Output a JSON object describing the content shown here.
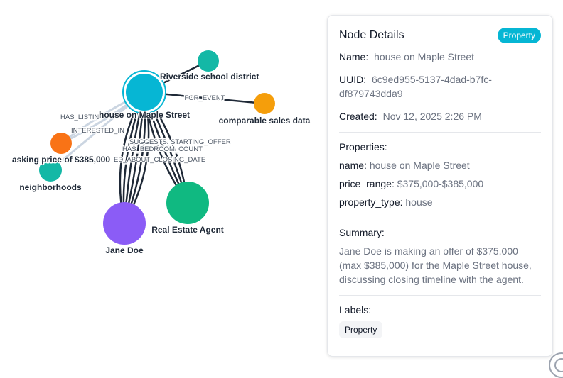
{
  "graph": {
    "colors": {
      "edge": "#1f2937",
      "edge_highlight": "#cbd5e1",
      "property": "#06b6d4",
      "entity": "#14b8a6",
      "event": "#f59e0b",
      "price": "#f97316",
      "person": "#8b5cf6",
      "agent": "#10b981",
      "selected_ring": "#06b6d4"
    },
    "nodes": [
      {
        "id": "house",
        "label": "house on Maple Street",
        "type": "property",
        "selected": true
      },
      {
        "id": "school",
        "label": "Riverside school district",
        "type": "entity"
      },
      {
        "id": "sales",
        "label": "comparable sales data",
        "type": "event"
      },
      {
        "id": "price",
        "label": "asking price of $385,000",
        "type": "price"
      },
      {
        "id": "hoods",
        "label": "neighborhoods",
        "type": "entity"
      },
      {
        "id": "jane",
        "label": "Jane Doe",
        "type": "person"
      },
      {
        "id": "agent",
        "label": "Real Estate Agent",
        "type": "agent"
      }
    ],
    "edges": [
      {
        "from": "house",
        "to": "school",
        "count": 1
      },
      {
        "from": "house",
        "to": "sales",
        "count": 1
      },
      {
        "from": "house",
        "to": "price",
        "count": 2,
        "highlight": true
      },
      {
        "from": "house",
        "to": "hoods",
        "count": 1,
        "highlight": true
      },
      {
        "from": "house",
        "to": "jane",
        "count": 6
      },
      {
        "from": "house",
        "to": "agent",
        "count": 4
      }
    ],
    "edge_labels": [
      {
        "text": "FOR_EVENT",
        "anchor": "edge-sales"
      },
      {
        "text": "HAS_LISTIN",
        "anchor": "edge-listing"
      },
      {
        "text": "INTERESTED_IN",
        "anchor": "edge-interested"
      },
      {
        "text": "SUGGESTS_STARTING_OFFER",
        "anchor": "edge-offer"
      },
      {
        "text": "HAS_BEDROOM_COUNT",
        "anchor": "edge-bedroom"
      },
      {
        "text": "ED_ABOUT_CLOSING_DATE",
        "anchor": "edge-closing"
      }
    ]
  },
  "details": {
    "title": "Node Details",
    "badge": "Property",
    "name_key": "Name:",
    "name_val": "house on Maple Street",
    "uuid_key": "UUID:",
    "uuid_val": "6c9ed955-5137-4dad-b7fc-df879743dda9",
    "created_key": "Created:",
    "created_val": "Nov 12, 2025 2:26 PM",
    "properties_title": "Properties:",
    "props": [
      {
        "k": "name:",
        "v": "house on Maple Street"
      },
      {
        "k": "price_range:",
        "v": "$375,000-$385,000"
      },
      {
        "k": "property_type:",
        "v": "house"
      }
    ],
    "summary_title": "Summary:",
    "summary": "Jane Doe is making an offer of $375,000 (max $385,000) for the Maple Street house, discussing closing timeline with the agent.",
    "labels_title": "Labels:",
    "labels": [
      "Property"
    ]
  }
}
